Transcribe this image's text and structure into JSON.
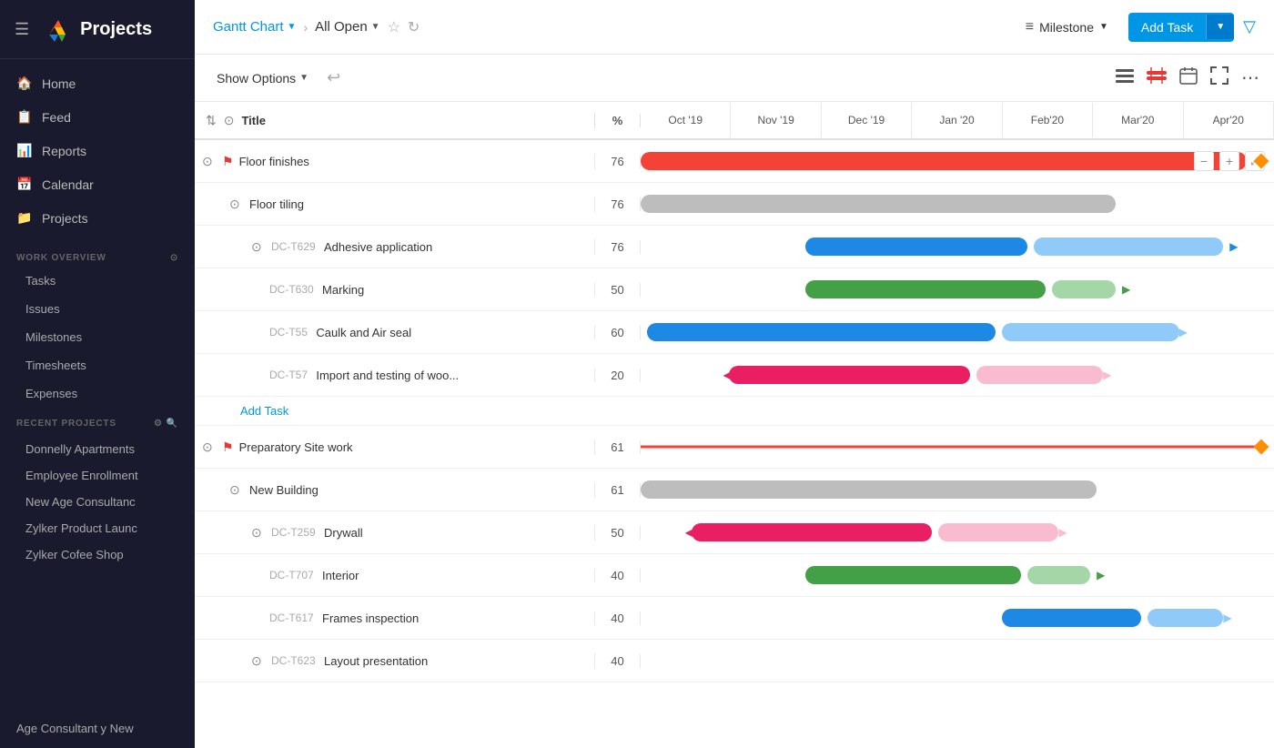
{
  "app": {
    "title": "Projects",
    "logo_alt": "Projects Logo"
  },
  "topbar": {
    "gantt_chart_label": "Gantt Chart",
    "all_open_label": "All Open",
    "milestone_label": "Milestone",
    "add_task_label": "Add Task",
    "show_options_label": "Show Options"
  },
  "columns": {
    "title_label": "Title",
    "pct_label": "%"
  },
  "timeline": {
    "months": [
      "Oct '19",
      "Nov '19",
      "Dec '19",
      "Jan '20",
      "Feb'20",
      "Mar'20",
      "Apr'20"
    ]
  },
  "rows": [
    {
      "id": "",
      "name": "Floor finishes",
      "pct": "76",
      "type": "parent",
      "flag": true,
      "expand": true
    },
    {
      "id": "",
      "name": "Floor tiling",
      "pct": "76",
      "type": "group",
      "expand": true
    },
    {
      "id": "DC-T629",
      "name": "Adhesive application",
      "pct": "76",
      "type": "task",
      "expand": true
    },
    {
      "id": "DC-T630",
      "name": "Marking",
      "pct": "50",
      "type": "task"
    },
    {
      "id": "DC-T55",
      "name": "Caulk and Air seal",
      "pct": "60",
      "type": "task"
    },
    {
      "id": "DC-T57",
      "name": "Import and testing of woo...",
      "pct": "20",
      "type": "task"
    },
    {
      "id": "",
      "name": "Add Task",
      "pct": "",
      "type": "add_task"
    },
    {
      "id": "",
      "name": "Preparatory Site work",
      "pct": "61",
      "type": "parent",
      "flag": true,
      "expand": true
    },
    {
      "id": "",
      "name": "New Building",
      "pct": "61",
      "type": "group",
      "expand": true
    },
    {
      "id": "DC-T259",
      "name": "Drywall",
      "pct": "50",
      "type": "task",
      "expand": true
    },
    {
      "id": "DC-T707",
      "name": "Interior",
      "pct": "40",
      "type": "task"
    },
    {
      "id": "DC-T617",
      "name": "Frames inspection",
      "pct": "40",
      "type": "task"
    },
    {
      "id": "DC-T623",
      "name": "Layout presentation",
      "pct": "40",
      "type": "task",
      "expand": true
    }
  ],
  "sidebar": {
    "nav": [
      {
        "label": "Home",
        "icon": "🏠"
      },
      {
        "label": "Feed",
        "icon": "📋"
      },
      {
        "label": "Reports",
        "icon": "📊"
      },
      {
        "label": "Calendar",
        "icon": "📅"
      },
      {
        "label": "Projects",
        "icon": "📁"
      }
    ],
    "work_overview_title": "WORK OVERVIEW",
    "work_overview_items": [
      "Tasks",
      "Issues",
      "Milestones",
      "Timesheets",
      "Expenses"
    ],
    "recent_projects_title": "RECENT PROJECTS",
    "recent_projects": [
      "Donnelly Apartments",
      "Employee Enrollment",
      "New Age Consultanc",
      "Zylker Product Launc",
      "Zylker Cofee Shop"
    ],
    "bottom_label": "Age Consultant y New"
  }
}
